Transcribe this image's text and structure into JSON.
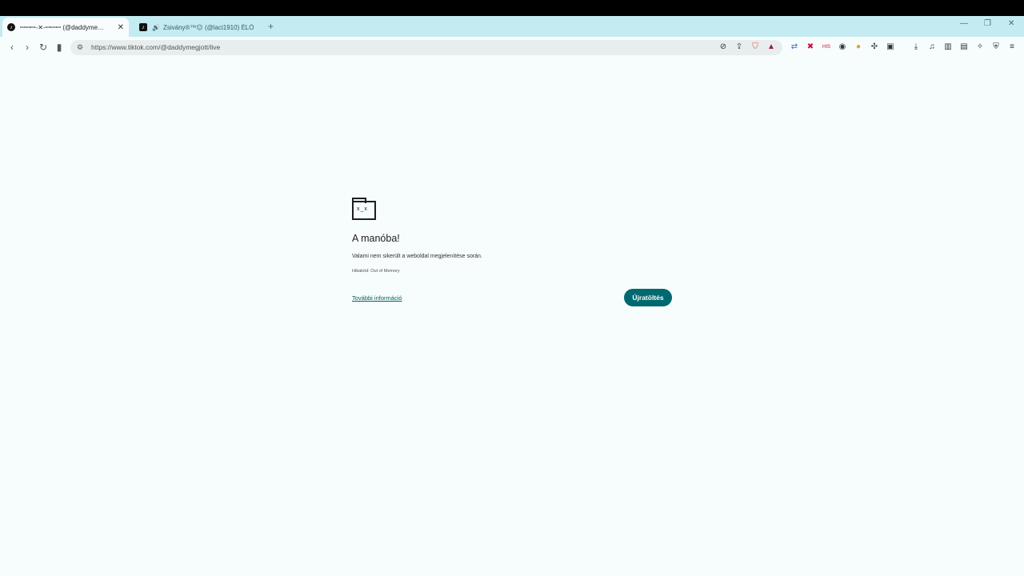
{
  "tabs": [
    {
      "title": "ꟷꟷꟷ-✕-ꟷꟷꟷ (@daddyme…",
      "active": true
    },
    {
      "title": "Zsivány®™😐 (@laci1910) ÉLŐ a…",
      "active": false
    }
  ],
  "address": {
    "url": "https://www.tiktok.com/@daddymegjott/live"
  },
  "error": {
    "heading": "A manóba!",
    "message": "Valami nem sikerült a weboldal megjelenítése során.",
    "code_label": "Hibakód: Out of Memory",
    "more_link": "További információ",
    "reload_label": "Újratöltés"
  },
  "icons": {
    "tab1_favicon": "tiktok-icon",
    "tab2_favicon": "tiktok-icon",
    "audio": "speaker-icon"
  },
  "colors": {
    "accent": "#00696f",
    "tabstrip": "#c3ebf1",
    "page": "#f7fcfc"
  }
}
